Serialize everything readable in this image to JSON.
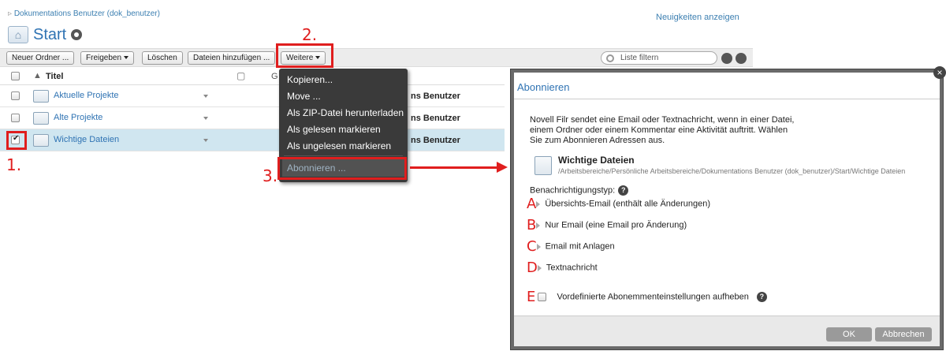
{
  "breadcrumb": "Dokumentations Benutzer (dok_benutzer)",
  "news_link": "Neuigkeiten anzeigen",
  "page_title": "Start",
  "toolbar": {
    "new_folder": "Neuer Ordner ...",
    "share": "Freigeben",
    "delete": "Löschen",
    "add_files": "Dateien hinzufügen ...",
    "more": "Weitere",
    "filter_placeholder": "Liste filtern"
  },
  "table": {
    "col_title": "Titel",
    "col_g": "G",
    "rows": [
      {
        "name": "Aktuelle Projekte",
        "user": "ns Benutzer",
        "checked": false
      },
      {
        "name": "Alte Projekte",
        "user": "ns Benutzer",
        "checked": false
      },
      {
        "name": "Wichtige Dateien",
        "user": "ns Benutzer",
        "checked": true
      }
    ]
  },
  "menu": {
    "items": [
      "Kopieren...",
      "Move ...",
      "Als ZIP-Datei herunterladen",
      "Als gelesen markieren",
      "Als ungelesen markieren",
      "Abonnieren ..."
    ]
  },
  "annotations": {
    "step1": "1.",
    "step2": "2.",
    "step3": "3."
  },
  "dialog": {
    "title": "Abonnieren",
    "description": [
      "Novell Filr sendet eine Email oder Textnachricht, wenn in einer Datei,",
      "einem Ordner oder einem Kommentar eine Aktivität auftritt. Wählen",
      "Sie zum Abonnieren Adressen aus."
    ],
    "folder_name": "Wichtige Dateien",
    "folder_path": "/Arbeitsbereiche/Persönliche Arbeitsbereiche/Dokumentations Benutzer (dok_benutzer)/Start/Wichtige Dateien",
    "notification_label": "Benachrichtigungstyp:",
    "options": [
      {
        "letter": "A",
        "label": "Übersichts-Email (enthält alle Änderungen)"
      },
      {
        "letter": "B",
        "label": "Nur Email (eine Email pro Änderung)"
      },
      {
        "letter": "C",
        "label": "Email mit Anlagen"
      },
      {
        "letter": "D",
        "label": "Textnachricht"
      }
    ],
    "override_letter": "E",
    "override_label": "Vordefinierte Abonemmenteinstellungen aufheben",
    "ok": "OK",
    "cancel": "Abbrechen"
  },
  "colors": {
    "accent": "#2f73b3",
    "annotation_red": "#e01e1e",
    "menu_bg": "#3a3a3a",
    "selected_row": "#d0e6f0"
  }
}
